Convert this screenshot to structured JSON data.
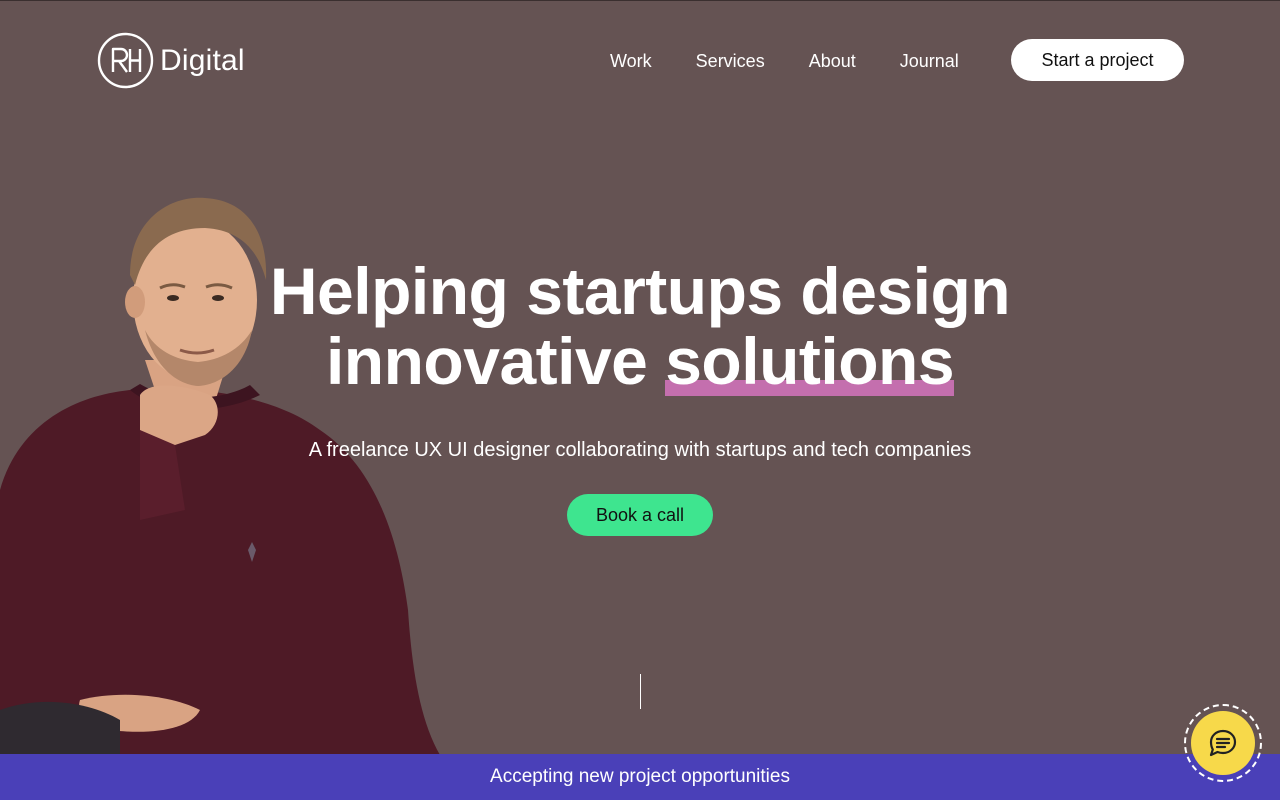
{
  "header": {
    "logo_monogram": "RH",
    "logo_text": "Digital",
    "nav": [
      {
        "label": "Work"
      },
      {
        "label": "Services"
      },
      {
        "label": "About"
      },
      {
        "label": "Journal"
      }
    ],
    "cta_label": "Start a project"
  },
  "hero": {
    "title_line1": "Helping startups design",
    "title_line2_a": "innovative ",
    "title_line2_highlight": "solutions",
    "subtitle": "A freelance UX UI designer collaborating with startups and tech companies",
    "button_label": "Book a call"
  },
  "banner": {
    "text": "Accepting new project opportunities"
  },
  "chat": {
    "icon": "chat-bubble-icon"
  },
  "colors": {
    "background": "#655353",
    "highlight": "#c46fae",
    "book_button": "#3ee58f",
    "banner": "#4a40b8",
    "chat": "#f7d94a"
  }
}
